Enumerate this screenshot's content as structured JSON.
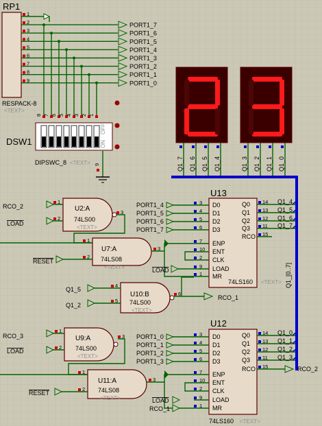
{
  "rp1": {
    "ref": "RP1",
    "value": "RESPACK-8",
    "text_tag": "<TEXT>",
    "pins": [
      "1",
      "2",
      "3",
      "4",
      "5",
      "6",
      "7",
      "8",
      "9"
    ]
  },
  "ports_top": [
    "PORT1_7",
    "PORT1_6",
    "PORT1_5",
    "PORT1_4",
    "PORT1_3",
    "PORT1_2",
    "PORT1_1",
    "PORT1_0"
  ],
  "dsw1": {
    "ref": "DSW1",
    "value": "DIPSWC_8",
    "text_tag": "<TEXT>",
    "pins": [
      "8",
      "7",
      "6",
      "5",
      "4",
      "3",
      "2",
      "1"
    ],
    "gnd_pin": "9",
    "side_labels": [
      "OFF",
      "ON"
    ]
  },
  "display_left": {
    "digit": "2",
    "pins": [
      "Q1_7",
      "Q1_6",
      "Q1_5",
      "Q1_4"
    ]
  },
  "display_right": {
    "digit": "3",
    "pins": [
      "Q1_3",
      "Q1_2",
      "Q1_1",
      "Q1_0"
    ]
  },
  "bus_label": "Q1_[0..7]",
  "u2": {
    "ref": "U2:A",
    "type": "74LS00",
    "text_tag": "<TEXT>",
    "in_labels": [
      "RCO_2",
      "LOAD"
    ],
    "pins": [
      "1",
      "2",
      "3"
    ]
  },
  "u7": {
    "ref": "U7:A",
    "type": "74LS08",
    "text_tag": "<TEXT>",
    "in_labels": [
      "RESET"
    ],
    "pins": [
      "1",
      "2",
      "3"
    ]
  },
  "u10": {
    "ref": "U10:B",
    "type": "74LS00",
    "text_tag": "<TEXT>",
    "in_labels": [
      "Q1_5",
      "Q1_2"
    ],
    "out_label": "RCO_1",
    "pins": [
      "4",
      "5",
      "6"
    ]
  },
  "u9": {
    "ref": "U9:A",
    "type": "74LS00",
    "text_tag": "<TEXT>",
    "in_labels": [
      "RCO_3",
      "LOAD"
    ],
    "pins": [
      "1",
      "2",
      "3"
    ]
  },
  "u11": {
    "ref": "U11:A",
    "type": "74LS08",
    "text_tag": "<TEXT>",
    "in_labels": [
      "RESET"
    ],
    "pins": [
      "1",
      "2",
      "3"
    ]
  },
  "u13": {
    "ref": "U13",
    "type": "74LS160",
    "text_tag": "<TEXT>",
    "left_pins": [
      {
        "net": "PORT1_4",
        "num": "3",
        "name": "D0"
      },
      {
        "net": "PORT1_5",
        "num": "4",
        "name": "D1"
      },
      {
        "net": "PORT1_6",
        "num": "5",
        "name": "D2"
      },
      {
        "net": "PORT1_7",
        "num": "6",
        "name": "D3"
      },
      {
        "net": "",
        "num": "7",
        "name": "ENP"
      },
      {
        "net": "",
        "num": "10",
        "name": "ENT"
      },
      {
        "net": "",
        "num": "2",
        "name": "CLK"
      },
      {
        "net": "LOAD",
        "num": "9",
        "name": "LOAD"
      },
      {
        "net": "",
        "num": "1",
        "name": "MR"
      }
    ],
    "right_pins": [
      {
        "net": "Q1_4",
        "num": "14",
        "name": "Q0"
      },
      {
        "net": "Q1_5",
        "num": "13",
        "name": "Q1"
      },
      {
        "net": "Q1_6",
        "num": "12",
        "name": "Q2"
      },
      {
        "net": "Q1_7",
        "num": "11",
        "name": "Q3"
      },
      {
        "net": "",
        "num": "15",
        "name": "RCO"
      }
    ]
  },
  "u12": {
    "ref": "U12",
    "type": "74LS160",
    "text_tag": "<TEXT>",
    "left_pins": [
      {
        "net": "PORT1_0",
        "num": "3",
        "name": "D0"
      },
      {
        "net": "PORT1_1",
        "num": "4",
        "name": "D1"
      },
      {
        "net": "PORT1_2",
        "num": "5",
        "name": "D2"
      },
      {
        "net": "PORT1_3",
        "num": "6",
        "name": "D3"
      },
      {
        "net": "",
        "num": "7",
        "name": "ENP"
      },
      {
        "net": "",
        "num": "10",
        "name": "ENT"
      },
      {
        "net": "",
        "num": "2",
        "name": "CLK"
      },
      {
        "net": "LOAD",
        "num": "9",
        "name": "LOAD"
      },
      {
        "net": "RCO_1",
        "num": "1",
        "name": "MR"
      }
    ],
    "right_pins": [
      {
        "net": "Q1_0",
        "num": "14",
        "name": "Q0"
      },
      {
        "net": "Q1_1",
        "num": "13",
        "name": "Q1"
      },
      {
        "net": "Q1_2",
        "num": "12",
        "name": "Q2"
      },
      {
        "net": "Q1_3",
        "num": "11",
        "name": "Q3"
      },
      {
        "net": "RCO_2",
        "num": "15",
        "name": "RCO"
      }
    ]
  },
  "colors": {
    "background": "#ccc8b6",
    "wire": "#006400",
    "bus": "#0000cc",
    "component_fill": "#e7dac9",
    "component_border": "#5a0000",
    "pin_red": "#cc0000",
    "pin_blue": "#0000cc",
    "segment_on": "#ff1a1a",
    "display_body": "#3a0000"
  }
}
